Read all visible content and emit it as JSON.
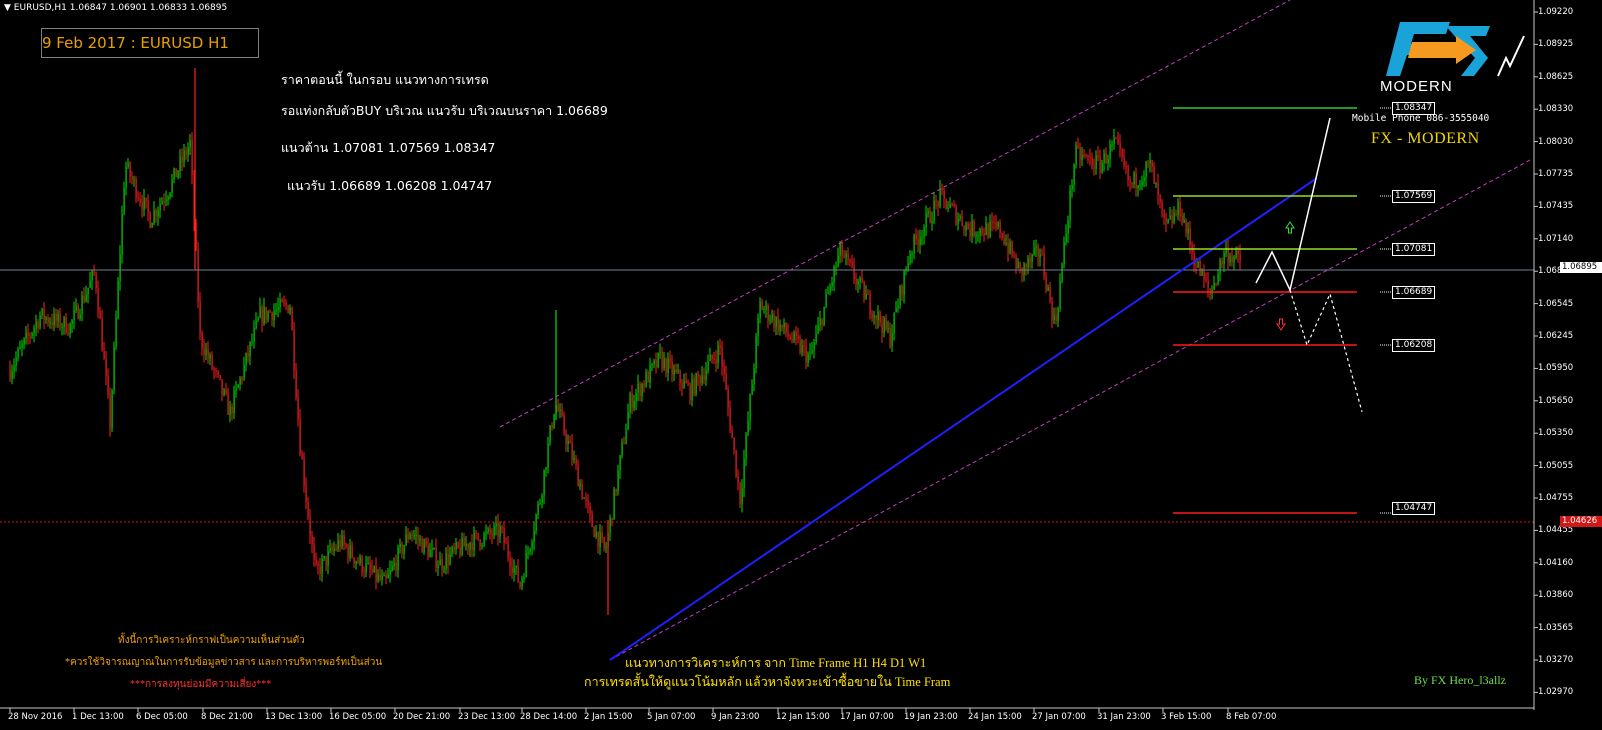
{
  "header": {
    "symbol_info": "EURUSD,H1  1.06847 1.06901 1.06833 1.06895"
  },
  "title_box": "9 Feb 2017 : EURUSD H1",
  "commentary": [
    "ราคาตอนนี้ ในกรอบ   แนวทางการเทรด",
    "รอแท่งกลับตัวBUY บริเวณ แนวรับ บริเวณบนราคา 1.06689",
    "แนวต้าน 1.07081  1.07569  1.08347",
    "แนวรับ 1.06689  1.06208  1.04747"
  ],
  "brand": {
    "logo_text": "FX",
    "logo_sub": "MODERN",
    "phone": "Mobile Phone 086-3555040",
    "name": "FX  -  MODERN"
  },
  "disclaimer": [
    "ทั้งนี้การวิเคราะห์กราฟเป็นความเห็นส่วนตัว",
    "*ควรใช้วิจารณญาณในการรับข้อมูลข่าวสาร และการบริหารพอร์ทเป็นส่วน",
    "***การลงทุนย่อมมีความเสี่ยง***"
  ],
  "annotation": [
    "แนวทางการวิเคราะห์การ จาก Time Frame H1 H4 D1 W1",
    "การเทรดสั้นให้ดูแนวโน้มหลัก แล้วหาจังหวะเข้าซื้อขายใน Time Fram"
  ],
  "signature": "By FX Hero_l3allz",
  "level_labels": [
    "1.08347",
    "1.07569",
    "1.07081",
    "1.06689",
    "1.06208",
    "1.04747"
  ],
  "price_axis": [
    "1.09220",
    "1.08925",
    "1.08625",
    "1.08330",
    "1.08030",
    "1.07735",
    "1.07435",
    "1.07140",
    "1.06840",
    "1.06545",
    "1.06245",
    "1.05950",
    "1.05650",
    "1.05350",
    "1.05055",
    "1.04755",
    "1.04455",
    "1.04160",
    "1.03860",
    "1.03565",
    "1.03270",
    "1.02970"
  ],
  "time_axis": [
    "28 Nov 2016",
    "1 Dec 13:00",
    "6 Dec 05:00",
    "8 Dec 21:00",
    "13 Dec 13:00",
    "16 Dec 05:00",
    "20 Dec 21:00",
    "23 Dec 13:00",
    "28 Dec 14:00",
    "2 Jan 15:00",
    "5 Jan 07:00",
    "9 Jan 23:00",
    "12 Jan 15:00",
    "17 Jan 07:00",
    "19 Jan 23:00",
    "24 Jan 15:00",
    "27 Jan 07:00",
    "31 Jan 23:00",
    "3 Feb 15:00",
    "8 Feb 07:00"
  ],
  "current_price": "1.06895",
  "alert_price": "1.04626",
  "colors": {
    "bull": "#00e000",
    "bear": "#ff2020",
    "resistance": "#90e020",
    "resistance_top": "#2ec82e",
    "support": "#ff1a1a",
    "trendline": "#1f20ff",
    "channel": "#c040c0",
    "alert": "#d01818",
    "current": "#708090"
  }
}
